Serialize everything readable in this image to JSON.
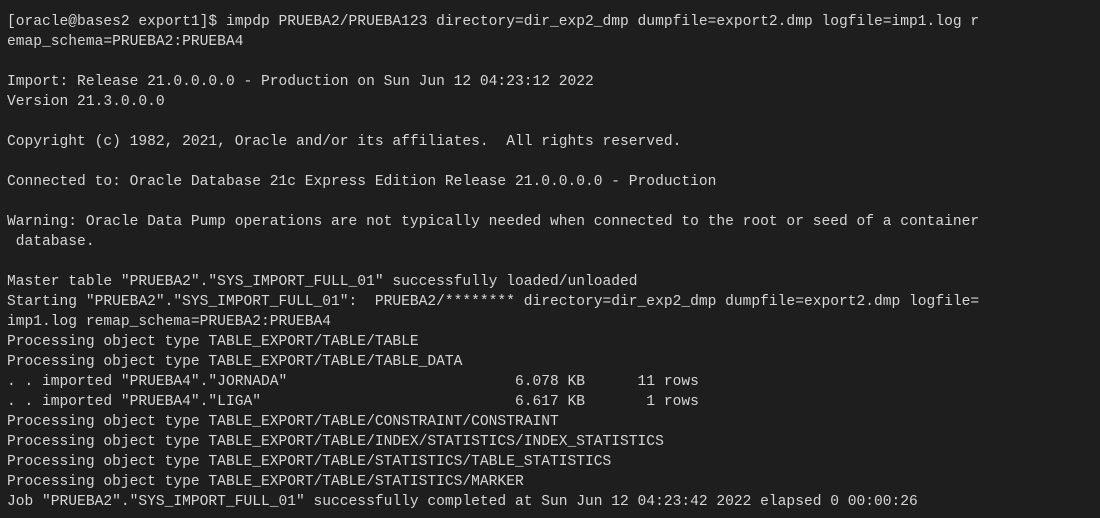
{
  "terminal": {
    "lines": [
      "[oracle@bases2 export1]$ impdp PRUEBA2/PRUEBA123 directory=dir_exp2_dmp dumpfile=export2.dmp logfile=imp1.log r",
      "emap_schema=PRUEBA2:PRUEBA4",
      "",
      "Import: Release 21.0.0.0.0 - Production on Sun Jun 12 04:23:12 2022",
      "Version 21.3.0.0.0",
      "",
      "Copyright (c) 1982, 2021, Oracle and/or its affiliates.  All rights reserved.",
      "",
      "Connected to: Oracle Database 21c Express Edition Release 21.0.0.0.0 - Production",
      "",
      "Warning: Oracle Data Pump operations are not typically needed when connected to the root or seed of a container",
      " database.",
      "",
      "Master table \"PRUEBA2\".\"SYS_IMPORT_FULL_01\" successfully loaded/unloaded",
      "Starting \"PRUEBA2\".\"SYS_IMPORT_FULL_01\":  PRUEBA2/******** directory=dir_exp2_dmp dumpfile=export2.dmp logfile=",
      "imp1.log remap_schema=PRUEBA2:PRUEBA4",
      "Processing object type TABLE_EXPORT/TABLE/TABLE",
      "Processing object type TABLE_EXPORT/TABLE/TABLE_DATA",
      ". . imported \"PRUEBA4\".\"JORNADA\"                          6.078 KB      11 rows",
      ". . imported \"PRUEBA4\".\"LIGA\"                             6.617 KB       1 rows",
      "Processing object type TABLE_EXPORT/TABLE/CONSTRAINT/CONSTRAINT",
      "Processing object type TABLE_EXPORT/TABLE/INDEX/STATISTICS/INDEX_STATISTICS",
      "Processing object type TABLE_EXPORT/TABLE/STATISTICS/TABLE_STATISTICS",
      "Processing object type TABLE_EXPORT/TABLE/STATISTICS/MARKER",
      "Job \"PRUEBA2\".\"SYS_IMPORT_FULL_01\" successfully completed at Sun Jun 12 04:23:42 2022 elapsed 0 00:00:26"
    ]
  }
}
